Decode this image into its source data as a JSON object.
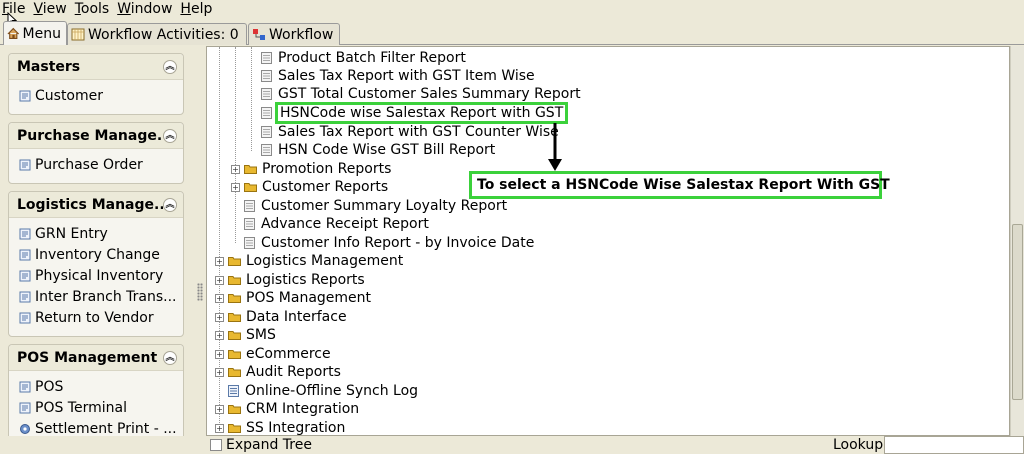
{
  "menubar": [
    "File",
    "View",
    "Tools",
    "Window",
    "Help"
  ],
  "tabs": {
    "menu": "Menu",
    "workflow_activities": "Workflow Activities: 0",
    "workflow": "Workflow"
  },
  "sidebar": {
    "masters": {
      "title": "Masters",
      "items": [
        "Customer"
      ]
    },
    "purchase": {
      "title": "Purchase Manage...",
      "items": [
        "Purchase Order"
      ]
    },
    "logistics": {
      "title": "Logistics Manage...",
      "items": [
        "GRN Entry",
        "Inventory Change",
        "Physical Inventory",
        "Inter Branch Trans...",
        "Return to Vendor"
      ]
    },
    "pos": {
      "title": "POS Management",
      "items": [
        "POS",
        "POS Terminal",
        "Settlement Print - ..."
      ]
    }
  },
  "tree": {
    "reports": [
      "Product Batch Filter Report",
      "Sales Tax Report with GST Item Wise",
      "GST Total Customer Sales Summary Report",
      "HSNCode wise Salestax Report with GST",
      "Sales Tax Report with GST Counter Wise",
      "HSN Code Wise GST Bill Report"
    ],
    "subfolders": [
      "Promotion Reports",
      "Customer Reports"
    ],
    "subleaves": [
      "Customer Summary Loyalty Report",
      "Advance Receipt Report",
      "Customer Info Report - by Invoice Date"
    ],
    "top": [
      {
        "label": "Logistics Management",
        "type": "folder"
      },
      {
        "label": "Logistics Reports",
        "type": "folder"
      },
      {
        "label": "POS Management",
        "type": "folder"
      },
      {
        "label": "Data Interface",
        "type": "folder"
      },
      {
        "label": "SMS",
        "type": "folder"
      },
      {
        "label": "eCommerce",
        "type": "folder"
      },
      {
        "label": "Audit Reports",
        "type": "folder"
      },
      {
        "label": "Online-Offline Synch Log",
        "type": "leaf"
      },
      {
        "label": "CRM Integration",
        "type": "folder"
      },
      {
        "label": "SS Integration",
        "type": "folder"
      }
    ]
  },
  "annotation": "To select a HSNCode Wise Salestax Report With GST",
  "bottom": {
    "expand_tree": "Expand Tree",
    "lookup": "Lookup"
  },
  "colors": {
    "highlight": "#3bd13b",
    "folder": "#e8b830"
  }
}
